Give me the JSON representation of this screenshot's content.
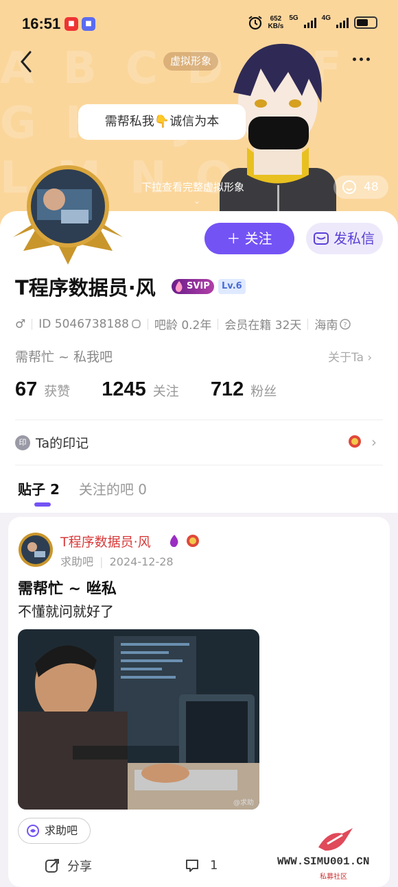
{
  "status_bar": {
    "time": "16:51",
    "speed_value": "652",
    "speed_unit": "KB/s",
    "network_1": "5G",
    "network_2": "4G"
  },
  "header": {
    "virtual_avatar_label": "虚拟形象",
    "speech_bubble": "需帮私我👇诚信为本",
    "pull_hint": "下拉查看完整虚拟形象",
    "likes_count": "48"
  },
  "profile": {
    "follow_button": "关注",
    "message_button": "发私信",
    "username": "T程序数据员·风",
    "svip_badge": "SVIP",
    "level_badge": "Lv.6",
    "gender": "♂",
    "id": "ID 5046738188",
    "bar_age": "吧龄 0.2年",
    "member_days": "会员在籍 32天",
    "location": "海南",
    "bio": "需帮忙 ~ 私我吧",
    "about_link": "关于Ta"
  },
  "stats": [
    {
      "value": "67",
      "label": "获赞"
    },
    {
      "value": "1245",
      "label": "关注"
    },
    {
      "value": "712",
      "label": "粉丝"
    }
  ],
  "mark": {
    "icon_text": "印",
    "label": "Ta的印记"
  },
  "tabs": [
    {
      "label": "贴子 2",
      "active": true
    },
    {
      "label": "关注的吧 0",
      "active": false
    }
  ],
  "post": {
    "author": "T程序数据员·风",
    "forum": "求助吧",
    "date": "2024-12-28",
    "title": "需帮忙 ~ 咝私",
    "body": "不懂就问就好了",
    "image_watermark": "@求助",
    "forum_chip": "求助吧",
    "share_label": "分享",
    "comment_count": "1"
  },
  "watermark": {
    "url": "WWW.SIMU001.CN",
    "sub": "私募社区"
  },
  "colors": {
    "accent": "#7453f5",
    "header_bg": "#fbd69b",
    "author_red": "#d83a3a"
  }
}
